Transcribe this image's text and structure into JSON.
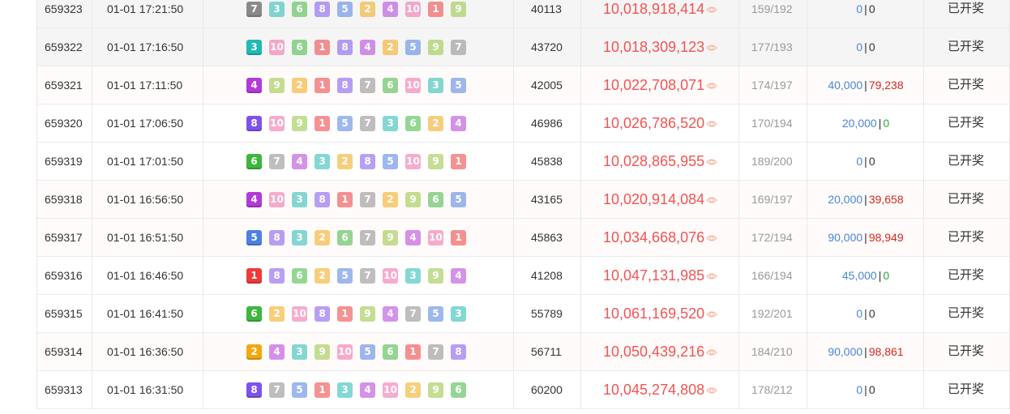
{
  "palette": {
    "1": "#ee3a3a",
    "2": "#f2a812",
    "3": "#21b9b1",
    "4": "#b13ad8",
    "5": "#4e7fe2",
    "6": "#3fb63f",
    "7": "#8a8a8a",
    "8": "#7e52ee",
    "9": "#94c43c",
    "10": "#f06aa8"
  },
  "rows": [
    {
      "issue": "659323",
      "time": "01-01 17:21:50",
      "balls": [
        "7",
        "3",
        "6",
        "8",
        "5",
        "2",
        "4",
        "10",
        "1",
        "9"
      ],
      "number": "40113",
      "total": "10,018,918,414",
      "ratio": "159/192",
      "win1": "0",
      "win2": "0",
      "win1_color": "blue",
      "win2_color": "dark",
      "status": "已开奖"
    },
    {
      "issue": "659322",
      "time": "01-01 17:16:50",
      "balls": [
        "3",
        "10",
        "6",
        "1",
        "8",
        "4",
        "2",
        "5",
        "9",
        "7"
      ],
      "number": "43720",
      "total": "10,018,309,123",
      "ratio": "177/193",
      "win1": "0",
      "win2": "0",
      "win1_color": "blue",
      "win2_color": "dark",
      "status": "已开奖"
    },
    {
      "issue": "659321",
      "time": "01-01 17:11:50",
      "balls": [
        "4",
        "9",
        "2",
        "1",
        "8",
        "7",
        "6",
        "10",
        "3",
        "5"
      ],
      "number": "42005",
      "total": "10,022,708,071",
      "ratio": "174/197",
      "win1": "40,000",
      "win2": "79,238",
      "win1_color": "blue",
      "win2_color": "red",
      "status": "已开奖"
    },
    {
      "issue": "659320",
      "time": "01-01 17:06:50",
      "balls": [
        "8",
        "10",
        "9",
        "1",
        "5",
        "7",
        "3",
        "6",
        "2",
        "4"
      ],
      "number": "46986",
      "total": "10,026,786,520",
      "ratio": "170/194",
      "win1": "20,000",
      "win2": "0",
      "win1_color": "blue",
      "win2_color": "green",
      "status": "已开奖"
    },
    {
      "issue": "659319",
      "time": "01-01 17:01:50",
      "balls": [
        "6",
        "7",
        "4",
        "3",
        "2",
        "8",
        "5",
        "10",
        "9",
        "1"
      ],
      "number": "45838",
      "total": "10,028,865,955",
      "ratio": "189/200",
      "win1": "0",
      "win2": "0",
      "win1_color": "blue",
      "win2_color": "dark",
      "status": "已开奖"
    },
    {
      "issue": "659318",
      "time": "01-01 16:56:50",
      "balls": [
        "4",
        "10",
        "3",
        "8",
        "1",
        "7",
        "2",
        "9",
        "6",
        "5"
      ],
      "number": "43165",
      "total": "10,020,914,084",
      "ratio": "169/197",
      "win1": "20,000",
      "win2": "39,658",
      "win1_color": "blue",
      "win2_color": "red",
      "status": "已开奖"
    },
    {
      "issue": "659317",
      "time": "01-01 16:51:50",
      "balls": [
        "5",
        "8",
        "3",
        "2",
        "6",
        "7",
        "9",
        "4",
        "10",
        "1"
      ],
      "number": "45863",
      "total": "10,034,668,076",
      "ratio": "172/194",
      "win1": "90,000",
      "win2": "98,949",
      "win1_color": "blue",
      "win2_color": "red",
      "status": "已开奖"
    },
    {
      "issue": "659316",
      "time": "01-01 16:46:50",
      "balls": [
        "1",
        "8",
        "6",
        "2",
        "5",
        "7",
        "10",
        "3",
        "9",
        "4"
      ],
      "number": "41208",
      "total": "10,047,131,985",
      "ratio": "166/194",
      "win1": "45,000",
      "win2": "0",
      "win1_color": "blue",
      "win2_color": "green",
      "status": "已开奖"
    },
    {
      "issue": "659315",
      "time": "01-01 16:41:50",
      "balls": [
        "6",
        "2",
        "10",
        "8",
        "1",
        "9",
        "4",
        "7",
        "5",
        "3"
      ],
      "number": "55789",
      "total": "10,061,169,520",
      "ratio": "192/201",
      "win1": "0",
      "win2": "0",
      "win1_color": "blue",
      "win2_color": "dark",
      "status": "已开奖"
    },
    {
      "issue": "659314",
      "time": "01-01 16:36:50",
      "balls": [
        "2",
        "4",
        "3",
        "9",
        "10",
        "5",
        "6",
        "1",
        "7",
        "8"
      ],
      "number": "56711",
      "total": "10,050,439,216",
      "ratio": "184/210",
      "win1": "90,000",
      "win2": "98,861",
      "win1_color": "blue",
      "win2_color": "red",
      "status": "已开奖"
    },
    {
      "issue": "659313",
      "time": "01-01 16:31:50",
      "balls": [
        "8",
        "7",
        "5",
        "1",
        "3",
        "4",
        "10",
        "2",
        "9",
        "6"
      ],
      "number": "60200",
      "total": "10,045,274,808",
      "ratio": "178/212",
      "win1": "0",
      "win2": "0",
      "win1_color": "blue",
      "win2_color": "dark",
      "status": "已开奖"
    }
  ]
}
